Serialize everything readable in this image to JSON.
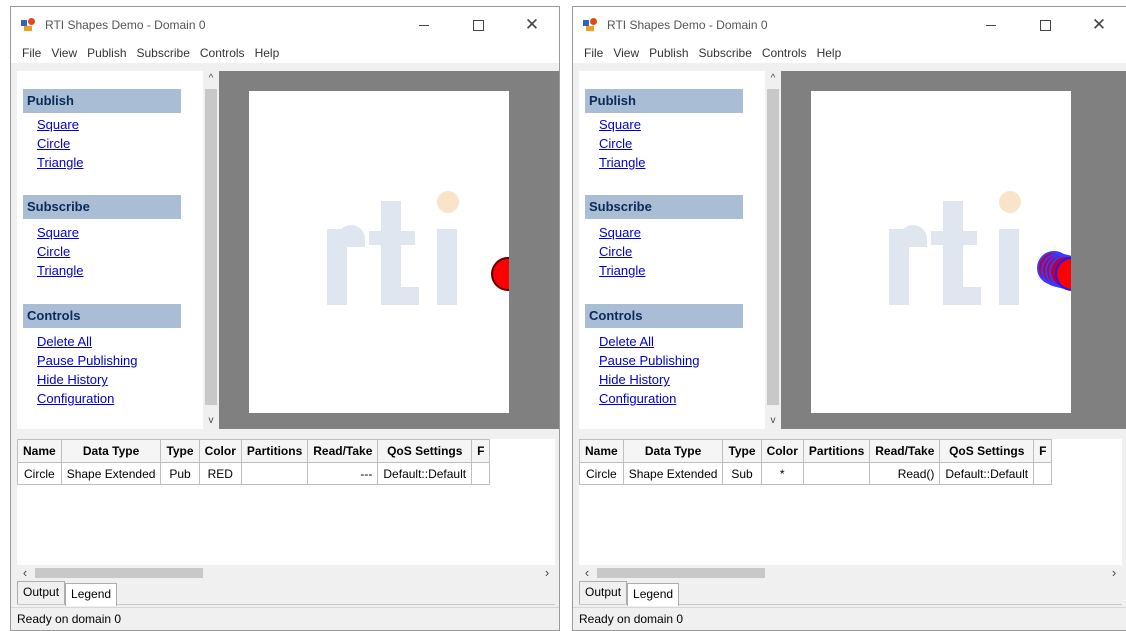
{
  "windows": [
    {
      "title": "RTI Shapes Demo - Domain 0",
      "menu": [
        "File",
        "View",
        "Publish",
        "Subscribe",
        "Controls",
        "Help"
      ],
      "sections": [
        {
          "header": "Publish",
          "links": [
            "Square",
            "Circle",
            "Triangle"
          ]
        },
        {
          "header": "Subscribe",
          "links": [
            "Square",
            "Circle",
            "Triangle"
          ]
        },
        {
          "header": "Controls",
          "links": [
            "Delete All",
            "Pause Publishing",
            "Hide History",
            "Configuration"
          ]
        }
      ],
      "table": {
        "columns": [
          "Name",
          "Data Type",
          "Type",
          "Color",
          "Partitions",
          "Read/Take",
          "QoS Settings",
          "F"
        ],
        "rows": [
          [
            "Circle",
            "Shape Extended",
            "Pub",
            "RED",
            "",
            "---",
            "Default::Default",
            ""
          ]
        ]
      },
      "tabs": [
        "Output",
        "Legend"
      ],
      "status": "Ready on domain 0"
    },
    {
      "title": "RTI Shapes Demo - Domain 0",
      "menu": [
        "File",
        "View",
        "Publish",
        "Subscribe",
        "Controls",
        "Help"
      ],
      "sections": [
        {
          "header": "Publish",
          "links": [
            "Square",
            "Circle",
            "Triangle"
          ]
        },
        {
          "header": "Subscribe",
          "links": [
            "Square",
            "Circle",
            "Triangle"
          ]
        },
        {
          "header": "Controls",
          "links": [
            "Delete All",
            "Pause Publishing",
            "Hide History",
            "Configuration"
          ]
        }
      ],
      "table": {
        "columns": [
          "Name",
          "Data Type",
          "Type",
          "Color",
          "Partitions",
          "Read/Take",
          "QoS Settings",
          "F"
        ],
        "rows": [
          [
            "Circle",
            "Shape Extended",
            "Sub",
            "*",
            "",
            "Read()",
            "Default::Default",
            ""
          ]
        ]
      },
      "tabs": [
        "Output",
        "Legend"
      ],
      "status": "Ready on domain 0"
    }
  ],
  "colors": {
    "section_header_bg": "#a9bed4",
    "link": "#0000cc",
    "canvas_frame": "#808080",
    "published_circle": "#ff0000",
    "subscriber_outline": "#1a1aff"
  },
  "icons": {
    "app": "rti-shapes-icon",
    "minimize": "minimize-icon",
    "maximize": "maximize-icon",
    "close": "close-icon"
  }
}
